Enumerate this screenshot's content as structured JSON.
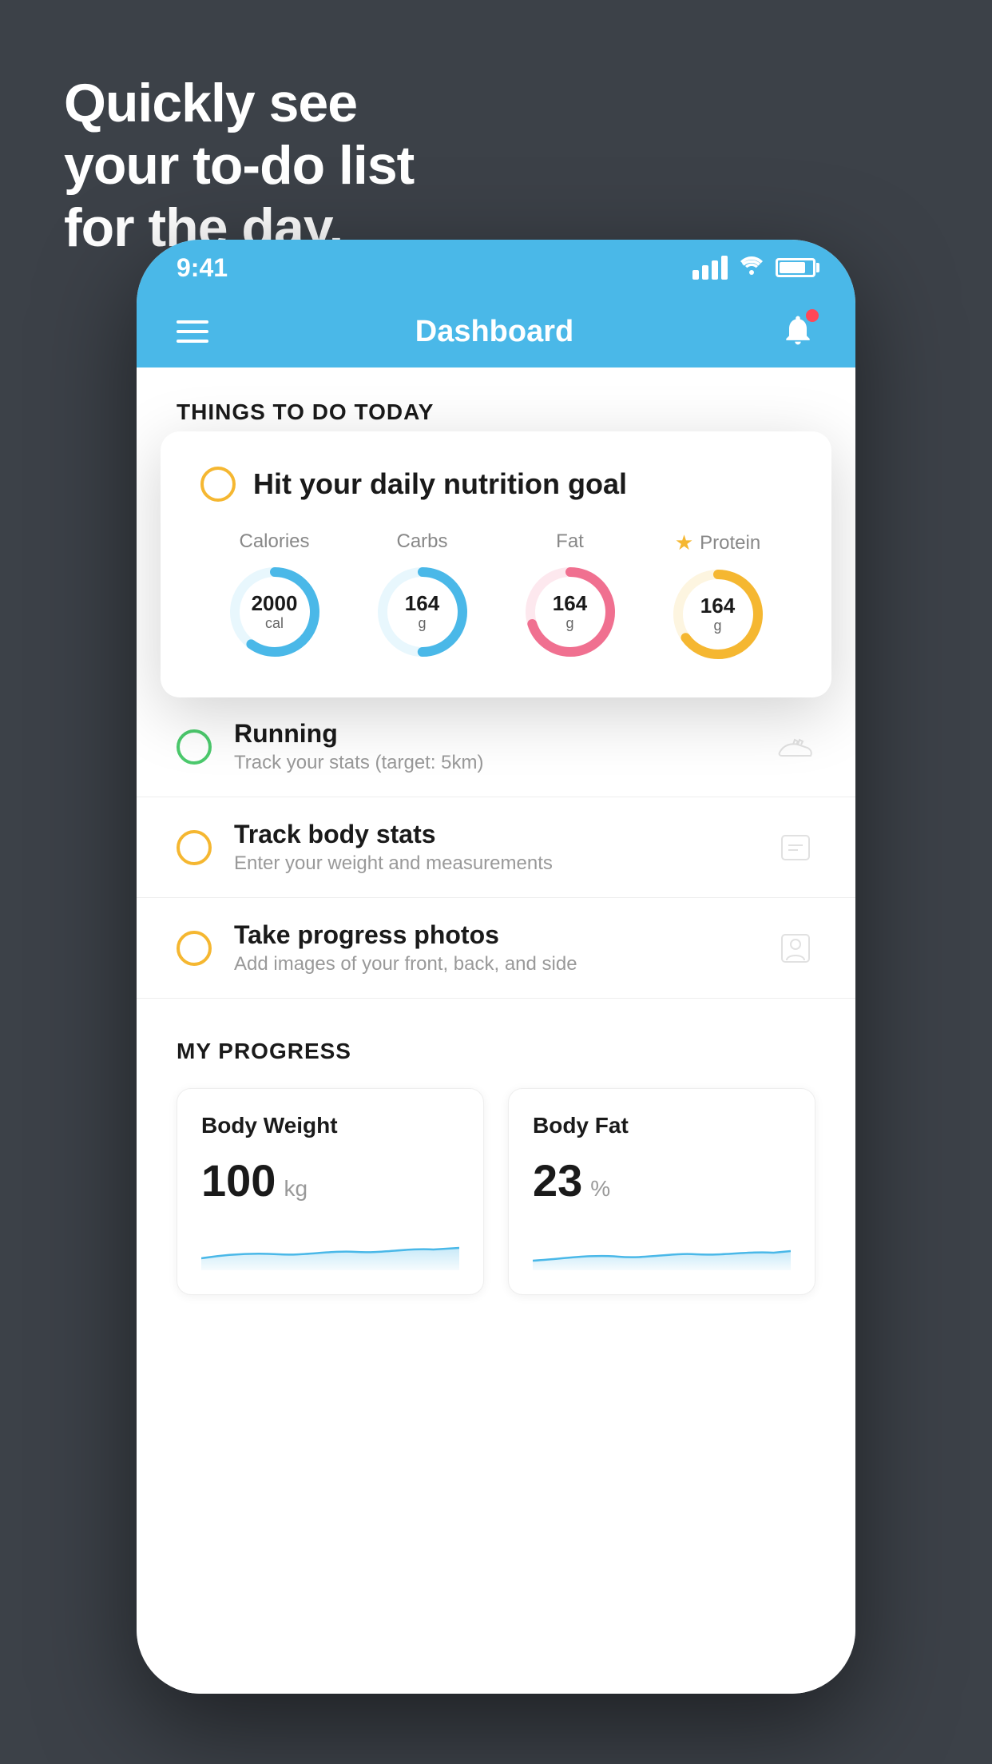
{
  "hero": {
    "line1": "Quickly see",
    "line2": "your to-do list",
    "line3": "for the day."
  },
  "phone": {
    "statusBar": {
      "time": "9:41"
    },
    "navBar": {
      "title": "Dashboard"
    },
    "sectionHeader": "THINGS TO DO TODAY",
    "floatingCard": {
      "title": "Hit your daily nutrition goal",
      "nutrition": [
        {
          "label": "Calories",
          "value": "2000",
          "unit": "cal",
          "color": "#4ab8e8",
          "bgColor": "#e8f7fd",
          "progress": 0.6,
          "star": false
        },
        {
          "label": "Carbs",
          "value": "164",
          "unit": "g",
          "color": "#4ab8e8",
          "bgColor": "#e8f7fd",
          "progress": 0.5,
          "star": false
        },
        {
          "label": "Fat",
          "value": "164",
          "unit": "g",
          "color": "#f07090",
          "bgColor": "#fde8ee",
          "progress": 0.7,
          "star": false
        },
        {
          "label": "Protein",
          "value": "164",
          "unit": "g",
          "color": "#f5b731",
          "bgColor": "#fdf5e0",
          "progress": 0.65,
          "star": true
        }
      ]
    },
    "todoItems": [
      {
        "name": "Running",
        "sub": "Track your stats (target: 5km)",
        "iconColor": "green",
        "iconType": "shoe"
      },
      {
        "name": "Track body stats",
        "sub": "Enter your weight and measurements",
        "iconColor": "yellow",
        "iconType": "scale"
      },
      {
        "name": "Take progress photos",
        "sub": "Add images of your front, back, and side",
        "iconColor": "yellow",
        "iconType": "person"
      }
    ],
    "progressSection": {
      "title": "MY PROGRESS",
      "cards": [
        {
          "title": "Body Weight",
          "value": "100",
          "unit": "kg"
        },
        {
          "title": "Body Fat",
          "value": "23",
          "unit": "%"
        }
      ]
    }
  }
}
